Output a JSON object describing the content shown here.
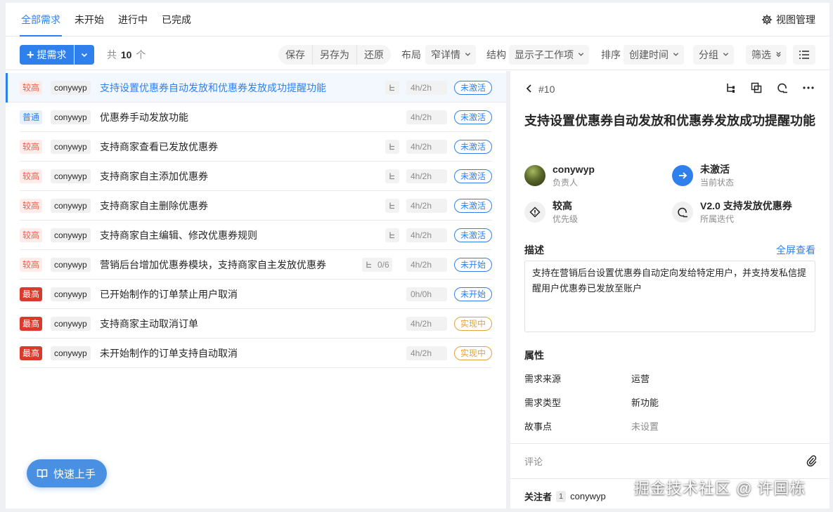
{
  "tabs": [
    {
      "label": "全部需求",
      "active": true
    },
    {
      "label": "未开始"
    },
    {
      "label": "进行中"
    },
    {
      "label": "已完成"
    }
  ],
  "view_manage_label": "视图管理",
  "toolbar": {
    "add_label": "提需求",
    "count_prefix": "共",
    "count_value": "10",
    "count_suffix": "个",
    "save": "保存",
    "save_as": "另存为",
    "restore": "还原",
    "layout_label": "布局",
    "layout_value": "窄详情",
    "structure_label": "结构",
    "structure_value": "显示子工作项",
    "sort_label": "排序",
    "sort_value": "创建时间",
    "group_label": "分组",
    "filter_label": "筛选"
  },
  "items": [
    {
      "priority": "较高",
      "owner": "conywyp",
      "title": "支持设置优惠券自动发放和优惠券发放成功提醒功能",
      "sub": "",
      "hours": "4h/2h",
      "status": "未激活"
    },
    {
      "priority": "普通",
      "owner": "conywyp",
      "title": "优惠券手动发放功能",
      "sub": "",
      "hours": "4h/2h",
      "status": "未激活"
    },
    {
      "priority": "较高",
      "owner": "conywyp",
      "title": "支持商家查看已发放优惠券",
      "sub": "",
      "hours": "4h/2h",
      "status": "未激活"
    },
    {
      "priority": "较高",
      "owner": "conywyp",
      "title": "支持商家自主添加优惠券",
      "sub": "",
      "hours": "4h/2h",
      "status": "未激活"
    },
    {
      "priority": "较高",
      "owner": "conywyp",
      "title": "支持商家自主删除优惠券",
      "sub": "",
      "hours": "4h/2h",
      "status": "未激活"
    },
    {
      "priority": "较高",
      "owner": "conywyp",
      "title": "支持商家自主编辑、修改优惠券规则",
      "sub": "",
      "hours": "4h/2h",
      "status": "未激活"
    },
    {
      "priority": "较高",
      "owner": "conywyp",
      "title": "营销后台增加优惠券模块，支持商家自主发放优惠券",
      "sub": "0/6",
      "hours": "4h/2h",
      "status": "未开始"
    },
    {
      "priority": "最高",
      "owner": "conywyp",
      "title": "已开始制作的订单禁止用户取消",
      "sub": "",
      "hours": "0h/0h",
      "status": "未开始"
    },
    {
      "priority": "最高",
      "owner": "conywyp",
      "title": "支持商家主动取消订单",
      "sub": "",
      "hours": "4h/2h",
      "status": "实现中"
    },
    {
      "priority": "最高",
      "owner": "conywyp",
      "title": "未开始制作的订单支持自动取消",
      "sub": "",
      "hours": "4h/2h",
      "status": "实现中"
    }
  ],
  "quick_start_label": "快速上手",
  "detail": {
    "id": "#10",
    "title": "支持设置优惠券自动发放和优惠券发放成功提醒功能",
    "owner": {
      "value": "conywyp",
      "label": "负责人"
    },
    "state": {
      "value": "未激活",
      "label": "当前状态"
    },
    "priority": {
      "value": "较高",
      "label": "优先级"
    },
    "iteration": {
      "value": "V2.0 支持发放优惠券",
      "label": "所属迭代"
    },
    "desc_title": "描述",
    "fullscreen": "全屏查看",
    "description": "支持在营销后台设置优惠券自动定向发给特定用户，并支持发私信提醒用户优惠券已发放至账户",
    "props_title": "属性",
    "props": [
      {
        "label": "需求来源",
        "value": "运营"
      },
      {
        "label": "需求类型",
        "value": "新功能"
      },
      {
        "label": "故事点",
        "value": "未设置"
      }
    ],
    "comment_placeholder": "评论",
    "followers_label": "关注者",
    "followers_count": "1",
    "followers_name": "conywyp"
  },
  "watermark": "掘金技术社区 @ 许国栋",
  "colors": {
    "accent": "#2f80ed",
    "high": "#e8604c",
    "top": "#d93a2b",
    "doing": "#e6a23c"
  }
}
